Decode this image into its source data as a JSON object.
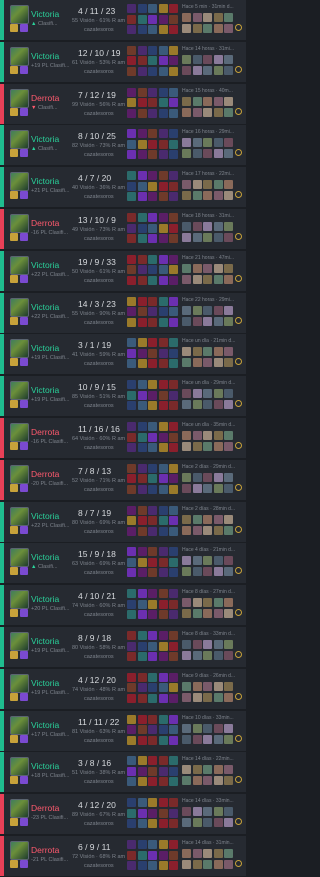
{
  "labels": {
    "win": "Victoria",
    "loss": "Derrota",
    "role": "cazatesoros",
    "vision_suffix": "Visión · ",
    "vision_tail": " R am"
  },
  "colors": {
    "win": "#2ad19a",
    "loss": "#ff5a6e",
    "row_bg": "#262a31",
    "page_bg": "#1b1e23"
  },
  "matches": [
    {
      "result": "Victoria",
      "lp": "Clasifi...",
      "lp_arrow": "▲",
      "kda": "4 / 11 / 23",
      "vision": "55 Visión · 61% R am",
      "role": "cazatesoros",
      "time": "Hace 5 min · 31min d..."
    },
    {
      "result": "Victoria",
      "lp": "+19 PL Clasifi...",
      "lp_arrow": "",
      "kda": "12 / 10 / 19",
      "vision": "61 Visión · 53% R am",
      "role": "cazatesoros",
      "time": "Hace 14 horas · 31mi..."
    },
    {
      "result": "Derrota",
      "lp": "Clasifi...",
      "lp_arrow": "▼",
      "kda": "7 / 12 / 19",
      "vision": "99 Visión · 56% R am",
      "role": "cazatesoros",
      "time": "Hace 15 horas · 40m..."
    },
    {
      "result": "Victoria",
      "lp": "Clasifi...",
      "lp_arrow": "▲",
      "kda": "8 / 10 / 25",
      "vision": "82 Visión · 73% R am",
      "role": "cazatesoros",
      "time": "Hace 16 horas · 29mi..."
    },
    {
      "result": "Victoria",
      "lp": "+21 PL Clasifi...",
      "lp_arrow": "",
      "kda": "4 / 7 / 20",
      "vision": "40 Visión · 36% R am",
      "role": "cazatesoros",
      "time": "Hace 17 horas · 22mi..."
    },
    {
      "result": "Derrota",
      "lp": "-16 PL Clasifi...",
      "lp_arrow": "",
      "kda": "13 / 10 / 9",
      "vision": "49 Visión · 73% R am",
      "role": "cazatesoros",
      "time": "Hace 18 horas · 31mi..."
    },
    {
      "result": "Victoria",
      "lp": "+22 PL Clasifi...",
      "lp_arrow": "",
      "kda": "19 / 9 / 33",
      "vision": "50 Visión · 61% R am",
      "role": "cazatesoros",
      "time": "Hace 21 horas · 47mi..."
    },
    {
      "result": "Victoria",
      "lp": "+22 PL Clasifi...",
      "lp_arrow": "",
      "kda": "14 / 3 / 23",
      "vision": "55 Visión · 90% R am",
      "role": "cazatesoros",
      "time": "Hace 22 horas · 29mi..."
    },
    {
      "result": "Victoria",
      "lp": "+19 PL Clasifi...",
      "lp_arrow": "",
      "kda": "3 / 1 / 19",
      "vision": "41 Visión · 59% R am",
      "role": "cazatesoros",
      "time": "Hace un día · 21min d..."
    },
    {
      "result": "Victoria",
      "lp": "+19 PL Clasifi...",
      "lp_arrow": "",
      "kda": "10 / 9 / 15",
      "vision": "85 Visión · 51% R am",
      "role": "cazatesoros",
      "time": "Hace un día · 29min d..."
    },
    {
      "result": "Derrota",
      "lp": "-16 PL Clasifi...",
      "lp_arrow": "",
      "kda": "11 / 16 / 16",
      "vision": "64 Visión · 60% R am",
      "role": "cazatesoros",
      "time": "Hace un día · 35min d..."
    },
    {
      "result": "Derrota",
      "lp": "-20 PL Clasifi...",
      "lp_arrow": "",
      "kda": "7 / 8 / 13",
      "vision": "52 Visión · 71% R am",
      "role": "cazatesoros",
      "time": "Hace 2 días · 29min d..."
    },
    {
      "result": "Victoria",
      "lp": "+22 PL Clasifi...",
      "lp_arrow": "",
      "kda": "8 / 7 / 19",
      "vision": "80 Visión · 69% R am",
      "role": "cazatesoros",
      "time": "Hace 2 días · 28min d..."
    },
    {
      "result": "Victoria",
      "lp": "Clasifi...",
      "lp_arrow": "▲",
      "kda": "15 / 9 / 18",
      "vision": "63 Visión · 69% R am",
      "role": "cazatesoros",
      "time": "Hace 4 días · 21min d..."
    },
    {
      "result": "Victoria",
      "lp": "+20 PL Clasifi...",
      "lp_arrow": "",
      "kda": "4 / 10 / 21",
      "vision": "74 Visión · 60% R am",
      "role": "cazatesoros",
      "time": "Hace 8 días · 27min d..."
    },
    {
      "result": "Victoria",
      "lp": "+19 PL Clasifi...",
      "lp_arrow": "",
      "kda": "8 / 9 / 18",
      "vision": "80 Visión · 58% R am",
      "role": "cazatesoros",
      "time": "Hace 8 días · 33min d..."
    },
    {
      "result": "Victoria",
      "lp": "+19 PL Clasifi...",
      "lp_arrow": "",
      "kda": "4 / 12 / 20",
      "vision": "74 Visión · 48% R am",
      "role": "cazatesoros",
      "time": "Hace 9 días · 26min d..."
    },
    {
      "result": "Victoria",
      "lp": "+17 PL Clasifi...",
      "lp_arrow": "",
      "kda": "11 / 11 / 22",
      "vision": "81 Visión · 63% R am",
      "role": "cazatesoros",
      "time": "Hace 10 días · 33min..."
    },
    {
      "result": "Victoria",
      "lp": "+18 PL Clasifi...",
      "lp_arrow": "",
      "kda": "3 / 8 / 16",
      "vision": "51 Visión · 38% R am",
      "role": "cazatesoros",
      "time": "Hace 14 días · 22min..."
    },
    {
      "result": "Derrota",
      "lp": "-23 PL Clasifi...",
      "lp_arrow": "",
      "kda": "4 / 12 / 20",
      "vision": "89 Visión · 67% R am",
      "role": "cazatesoros",
      "time": "Hace 14 días · 33min..."
    },
    {
      "result": "Derrota",
      "lp": "-21 PL Clasifi...",
      "lp_arrow": "",
      "kda": "6 / 9 / 11",
      "vision": "72 Visión · 68% R am",
      "role": "cazatesoros",
      "time": "Hace 14 días · 31min..."
    }
  ]
}
